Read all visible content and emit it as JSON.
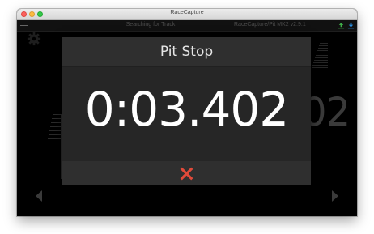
{
  "window": {
    "title": "RaceCapture"
  },
  "app_bar": {
    "status": "Searching for Track",
    "device": "RaceCapture/Pit MK2 v2.9.1"
  },
  "background": {
    "readout_partial": "02"
  },
  "modal": {
    "title": "Pit Stop",
    "time": "0:03.402",
    "close_icon": "close-x-icon",
    "close_color": "#e04a3a"
  },
  "colors": {
    "accent_green": "#3fae49",
    "accent_blue": "#2b8ee0"
  }
}
